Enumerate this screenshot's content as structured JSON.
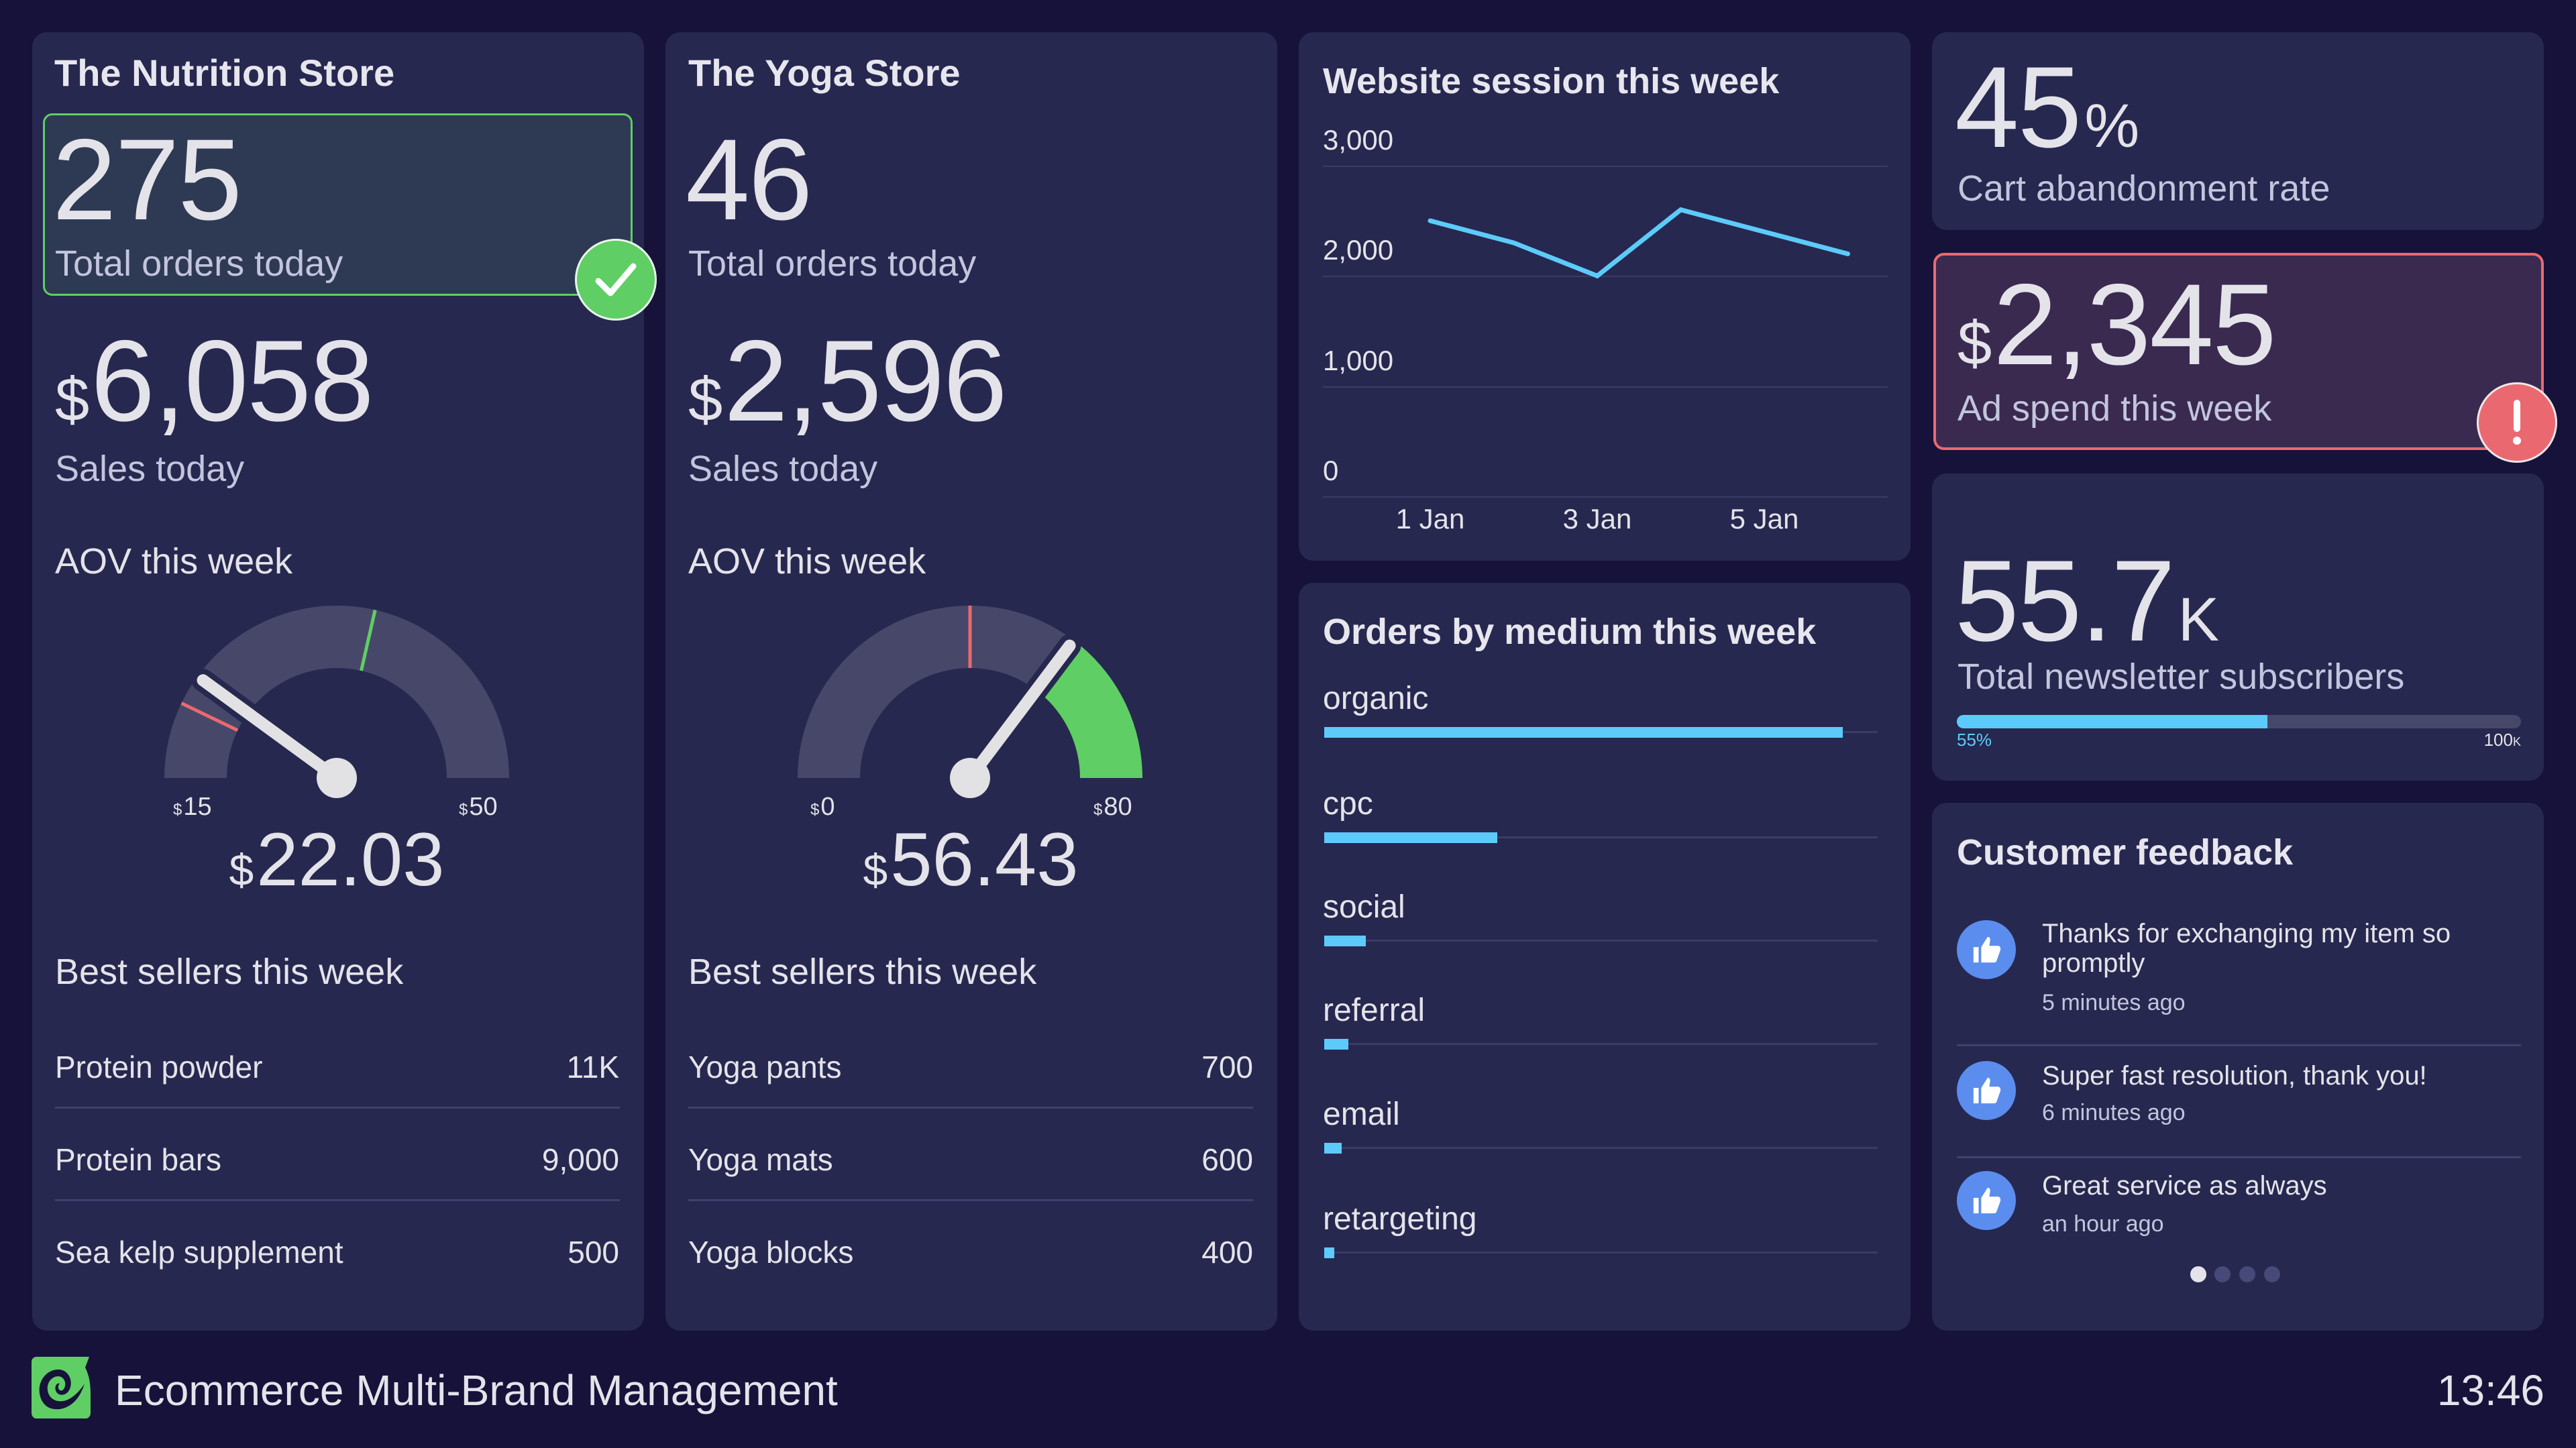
{
  "colors": {
    "background": "#16123a",
    "panel": "#27284f",
    "accent_blue": "#5ccbfa",
    "success_green": "#5fce65",
    "alert_red": "#ea6970",
    "gauge_track": "#474869",
    "feedback_icon": "#5b8def"
  },
  "nutrition_store": {
    "title": "The Nutrition Store",
    "orders": {
      "value": "275",
      "label": "Total orders today",
      "status": "success",
      "status_icon": "check-icon"
    },
    "sales": {
      "currency": "$",
      "value": "6,058",
      "label": "Sales today"
    },
    "aov": {
      "label": "AOV this week",
      "currency": "$",
      "value_text": "22.03",
      "value": 22.03,
      "min": 15,
      "max": 50,
      "min_label": "15",
      "max_label": "50",
      "red_threshold": 20,
      "green_threshold": 35
    },
    "best_sellers": {
      "label": "Best sellers this week",
      "rows": [
        {
          "name": "Protein powder",
          "value": "11K"
        },
        {
          "name": "Protein bars",
          "value": "9,000"
        },
        {
          "name": "Sea kelp supplement",
          "value": "500"
        }
      ]
    }
  },
  "yoga_store": {
    "title": "The Yoga Store",
    "orders": {
      "value": "46",
      "label": "Total orders today"
    },
    "sales": {
      "currency": "$",
      "value": "2,596",
      "label": "Sales today"
    },
    "aov": {
      "label": "AOV this week",
      "currency": "$",
      "value_text": "56.43",
      "value": 56.43,
      "min": 0,
      "max": 80,
      "min_label": "0",
      "max_label": "80",
      "red_threshold": 40,
      "green_fill_from_value": true
    },
    "best_sellers": {
      "label": "Best sellers this week",
      "rows": [
        {
          "name": "Yoga pants",
          "value": "700"
        },
        {
          "name": "Yoga mats",
          "value": "600"
        },
        {
          "name": "Yoga blocks",
          "value": "400"
        }
      ]
    }
  },
  "website_sessions": {
    "title": "Website session this week"
  },
  "orders_by_medium": {
    "title": "Orders by medium this week"
  },
  "cart_abandonment": {
    "value": "45",
    "suffix": "%",
    "label": "Cart abandonment rate"
  },
  "ad_spend": {
    "currency": "$",
    "value": "2,345",
    "label": "Ad spend this week",
    "status": "alert",
    "status_icon": "exclamation-icon"
  },
  "newsletter": {
    "value": "55.7",
    "suffix": "K",
    "label": "Total newsletter subscribers",
    "progress": 0.55,
    "progress_label": "55%",
    "target_label": "100",
    "target_suffix": "K"
  },
  "customer_feedback": {
    "title": "Customer feedback",
    "items": [
      {
        "icon": "thumbs-up-icon",
        "text": "Thanks for exchanging my item so promptly",
        "time": "5 minutes ago"
      },
      {
        "icon": "thumbs-up-icon",
        "text": "Super fast resolution, thank you!",
        "time": "6 minutes ago"
      },
      {
        "icon": "thumbs-up-icon",
        "text": "Great service as always",
        "time": "an hour ago"
      }
    ],
    "pagination": {
      "pages": 4,
      "active": 0
    }
  },
  "footer": {
    "title": "Ecommerce Multi-Brand Management",
    "time": "13:46",
    "logo_icon": "swirl-logo-icon"
  },
  "chart_data": [
    {
      "type": "line",
      "title": "Website session this week",
      "x": [
        "1 Jan",
        "2 Jan",
        "3 Jan",
        "4 Jan",
        "5 Jan",
        "6 Jan"
      ],
      "x_tick_labels": [
        "1 Jan",
        "3 Jan",
        "5 Jan"
      ],
      "series": [
        {
          "name": "Sessions",
          "values": [
            2500,
            2300,
            2000,
            2600,
            2400,
            2200
          ],
          "color": "#5ccbfa"
        }
      ],
      "y_tick_labels": [
        "3,000",
        "2,000",
        "1,000",
        "0"
      ],
      "y_ticks": [
        3000,
        2000,
        1000,
        0
      ],
      "ylim": [
        0,
        3000
      ],
      "grid": true,
      "xlabel": "",
      "ylabel": ""
    },
    {
      "type": "bar",
      "orientation": "horizontal",
      "title": "Orders by medium this week",
      "categories": [
        "organic",
        "cpc",
        "social",
        "referral",
        "email",
        "retargeting"
      ],
      "values": [
        15000,
        5000,
        1200,
        700,
        500,
        300
      ],
      "value_labels": [
        "15K",
        "5K",
        "1.2K",
        "0.7K",
        "0.5K",
        "0.3K"
      ],
      "xlim": [
        0,
        16000
      ],
      "color": "#5ccbfa"
    }
  ]
}
